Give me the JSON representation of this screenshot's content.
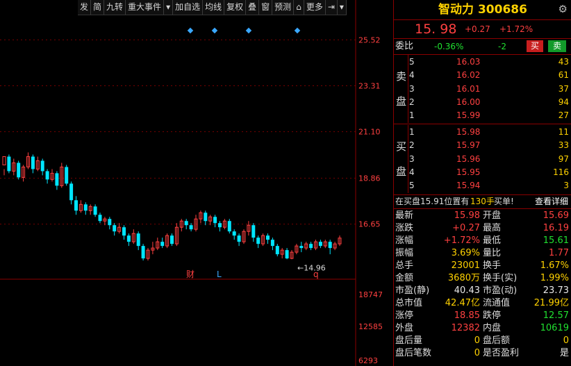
{
  "toolbar": {
    "items": [
      "发",
      "简",
      "九转",
      "重大事件",
      "▾",
      "加自选",
      "均线",
      "复权",
      "叠",
      "窗",
      "预测",
      "⌂",
      "更多",
      "⇥",
      "▾"
    ]
  },
  "chart": {
    "y_labels": [
      "25.52",
      "23.31",
      "21.10",
      "18.86",
      "16.65"
    ],
    "vol_labels": [
      "18747",
      "12585",
      "6293"
    ],
    "low_marker": "←14.96",
    "event_markers": [
      "财",
      "L",
      "q"
    ]
  },
  "chart_data": {
    "type": "candlestick",
    "ylim": [
      14.0,
      26.1
    ],
    "ticks": [
      25.52,
      23.31,
      21.1,
      18.86,
      16.65
    ],
    "candles": [
      [
        19.5,
        19.9,
        19.3,
        19.0
      ],
      [
        19.9,
        19.2,
        20.0,
        19.1
      ],
      [
        19.2,
        19.6,
        19.8,
        19.0
      ],
      [
        19.6,
        18.9,
        19.7,
        18.8
      ],
      [
        18.9,
        19.4,
        19.5,
        18.7
      ],
      [
        19.4,
        19.9,
        20.1,
        19.3
      ],
      [
        19.9,
        19.3,
        20.0,
        19.1
      ],
      [
        19.3,
        19.7,
        19.9,
        19.2
      ],
      [
        19.7,
        19.2,
        19.8,
        19.0
      ],
      [
        19.2,
        18.8,
        19.3,
        18.6
      ],
      [
        18.8,
        19.1,
        19.3,
        18.7
      ],
      [
        19.1,
        18.5,
        19.2,
        18.3
      ],
      [
        18.5,
        19.4,
        19.6,
        18.4
      ],
      [
        19.4,
        18.6,
        19.5,
        18.5
      ],
      [
        18.6,
        17.8,
        18.7,
        17.6
      ],
      [
        17.8,
        17.3,
        18.0,
        17.1
      ],
      [
        17.3,
        17.6,
        17.8,
        17.2
      ],
      [
        17.6,
        17.3,
        17.7,
        17.1
      ],
      [
        17.3,
        17.5,
        17.6,
        17.1
      ],
      [
        17.5,
        17.1,
        17.6,
        17.0
      ],
      [
        17.1,
        16.8,
        17.2,
        16.7
      ],
      [
        16.8,
        16.9,
        17.0,
        16.6
      ],
      [
        16.9,
        16.6,
        17.0,
        16.4
      ],
      [
        16.6,
        16.3,
        16.7,
        16.1
      ],
      [
        16.3,
        16.5,
        16.7,
        16.2
      ],
      [
        16.5,
        16.1,
        16.6,
        15.9
      ],
      [
        16.1,
        15.8,
        16.2,
        15.6
      ],
      [
        15.8,
        16.2,
        16.4,
        15.7
      ],
      [
        16.2,
        15.6,
        16.3,
        15.4
      ],
      [
        15.6,
        15.0,
        15.7,
        14.9
      ],
      [
        15.0,
        15.4,
        15.5,
        14.9
      ],
      [
        15.4,
        15.5,
        15.8,
        15.2
      ],
      [
        15.5,
        15.8,
        16.0,
        15.4
      ],
      [
        15.8,
        15.6,
        16.0,
        15.5
      ],
      [
        15.6,
        16.1,
        16.2,
        15.5
      ],
      [
        16.1,
        15.7,
        16.2,
        15.6
      ],
      [
        15.7,
        16.5,
        16.7,
        15.6
      ],
      [
        16.5,
        16.8,
        16.9,
        16.3
      ],
      [
        16.8,
        16.6,
        16.9,
        16.4
      ],
      [
        16.6,
        16.4,
        16.7,
        16.3
      ],
      [
        16.4,
        16.9,
        17.1,
        16.3
      ],
      [
        16.9,
        17.2,
        17.3,
        16.7
      ],
      [
        17.2,
        16.8,
        17.3,
        16.6
      ],
      [
        16.8,
        17.0,
        17.1,
        16.6
      ],
      [
        17.0,
        16.7,
        17.1,
        16.5
      ],
      [
        16.7,
        16.5,
        16.8,
        16.3
      ],
      [
        16.5,
        16.8,
        16.9,
        16.4
      ],
      [
        16.8,
        16.3,
        16.9,
        16.2
      ],
      [
        16.3,
        16.1,
        16.4,
        15.9
      ],
      [
        16.1,
        15.8,
        16.2,
        15.6
      ],
      [
        15.8,
        16.3,
        16.4,
        15.7
      ],
      [
        16.3,
        16.6,
        16.8,
        16.1
      ],
      [
        16.6,
        16.0,
        16.7,
        15.8
      ],
      [
        16.0,
        15.7,
        16.1,
        15.5
      ],
      [
        15.7,
        16.1,
        16.2,
        15.6
      ],
      [
        16.1,
        15.9,
        16.2,
        15.7
      ],
      [
        15.9,
        15.6,
        16.0,
        15.4
      ],
      [
        15.6,
        15.2,
        15.7,
        15.1
      ],
      [
        15.2,
        15.4,
        15.5,
        15.0
      ],
      [
        15.4,
        15.0,
        15.5,
        14.96
      ],
      [
        15.0,
        15.3,
        15.4,
        14.96
      ],
      [
        15.3,
        15.6,
        15.7,
        15.2
      ],
      [
        15.6,
        15.5,
        15.8,
        15.3
      ],
      [
        15.5,
        15.7,
        15.8,
        15.4
      ],
      [
        15.7,
        15.5,
        15.8,
        15.4
      ],
      [
        15.5,
        15.8,
        15.9,
        15.4
      ],
      [
        15.8,
        15.6,
        15.9,
        15.5
      ],
      [
        15.6,
        15.8,
        15.9,
        15.5
      ],
      [
        15.8,
        15.5,
        15.9,
        15.2
      ],
      [
        15.5,
        15.7,
        15.8,
        15.4
      ],
      [
        15.7,
        15.98,
        16.1,
        15.6
      ]
    ]
  },
  "stock": {
    "title": "智动力 300686",
    "price": "15. 98",
    "change": "+0.27",
    "pct": "+1.72%"
  },
  "weibi": {
    "label": "委比",
    "ratio": "-0.36%",
    "diff": "-2",
    "buy_btn": "买",
    "sell_btn": "卖"
  },
  "sell_side": {
    "chars": [
      "卖",
      "盘"
    ],
    "rows": [
      {
        "lv": "5",
        "price": "16.03",
        "vol": "43"
      },
      {
        "lv": "4",
        "price": "16.02",
        "vol": "61"
      },
      {
        "lv": "3",
        "price": "16.01",
        "vol": "37"
      },
      {
        "lv": "2",
        "price": "16.00",
        "vol": "94"
      },
      {
        "lv": "1",
        "price": "15.99",
        "vol": "27"
      }
    ]
  },
  "buy_side": {
    "chars": [
      "买",
      "盘"
    ],
    "rows": [
      {
        "lv": "1",
        "price": "15.98",
        "vol": "11"
      },
      {
        "lv": "2",
        "price": "15.97",
        "vol": "33"
      },
      {
        "lv": "3",
        "price": "15.96",
        "vol": "97"
      },
      {
        "lv": "4",
        "price": "15.95",
        "vol": "116"
      },
      {
        "lv": "5",
        "price": "15.94",
        "vol": "3"
      }
    ]
  },
  "notice": {
    "text": "在买盘15.91位置有",
    "count": "130手",
    "tail": "买单!",
    "link": "查看详细"
  },
  "stats": [
    {
      "l1": "最新",
      "v1": "15.98",
      "c1": "red",
      "l2": "开盘",
      "v2": "15.69",
      "c2": "red"
    },
    {
      "l1": "涨跌",
      "v1": "+0.27",
      "c1": "red",
      "l2": "最高",
      "v2": "16.19",
      "c2": "red"
    },
    {
      "l1": "涨幅",
      "v1": "+1.72%",
      "c1": "red",
      "l2": "最低",
      "v2": "15.61",
      "c2": "green"
    },
    {
      "l1": "振幅",
      "v1": "3.69%",
      "c1": "yellow",
      "l2": "量比",
      "v2": "1.77",
      "c2": "red"
    },
    {
      "l1": "总手",
      "v1": "23001",
      "c1": "yellow",
      "l2": "换手",
      "v2": "1.67%",
      "c2": "yellow"
    },
    {
      "l1": "金额",
      "v1": "3680万",
      "c1": "yellow",
      "l2": "换手(实)",
      "v2": "1.99%",
      "c2": "yellow"
    },
    {
      "l1": "市盈(静)",
      "v1": "40.43",
      "c1": "white",
      "l2": "市盈(动)",
      "v2": "23.73",
      "c2": "white"
    },
    {
      "l1": "总市值",
      "v1": "42.47亿",
      "c1": "yellow",
      "l2": "流通值",
      "v2": "21.99亿",
      "c2": "yellow"
    },
    {
      "l1": "涨停",
      "v1": "18.85",
      "c1": "red",
      "l2": "跌停",
      "v2": "12.57",
      "c2": "green"
    },
    {
      "l1": "外盘",
      "v1": "12382",
      "c1": "red",
      "l2": "内盘",
      "v2": "10619",
      "c2": "green"
    },
    {
      "l1": "盘后量",
      "v1": "0",
      "c1": "yellow",
      "l2": "盘后额",
      "v2": "0",
      "c2": "yellow"
    },
    {
      "l1": "盘后笔数",
      "v1": "0",
      "c1": "yellow",
      "l2": "是否盈利",
      "v2": "是",
      "c2": "white"
    }
  ],
  "colors": {
    "up": "#ff4040",
    "down": "#00e5ff",
    "frame": "#8b0000",
    "title": "#ffd200"
  }
}
